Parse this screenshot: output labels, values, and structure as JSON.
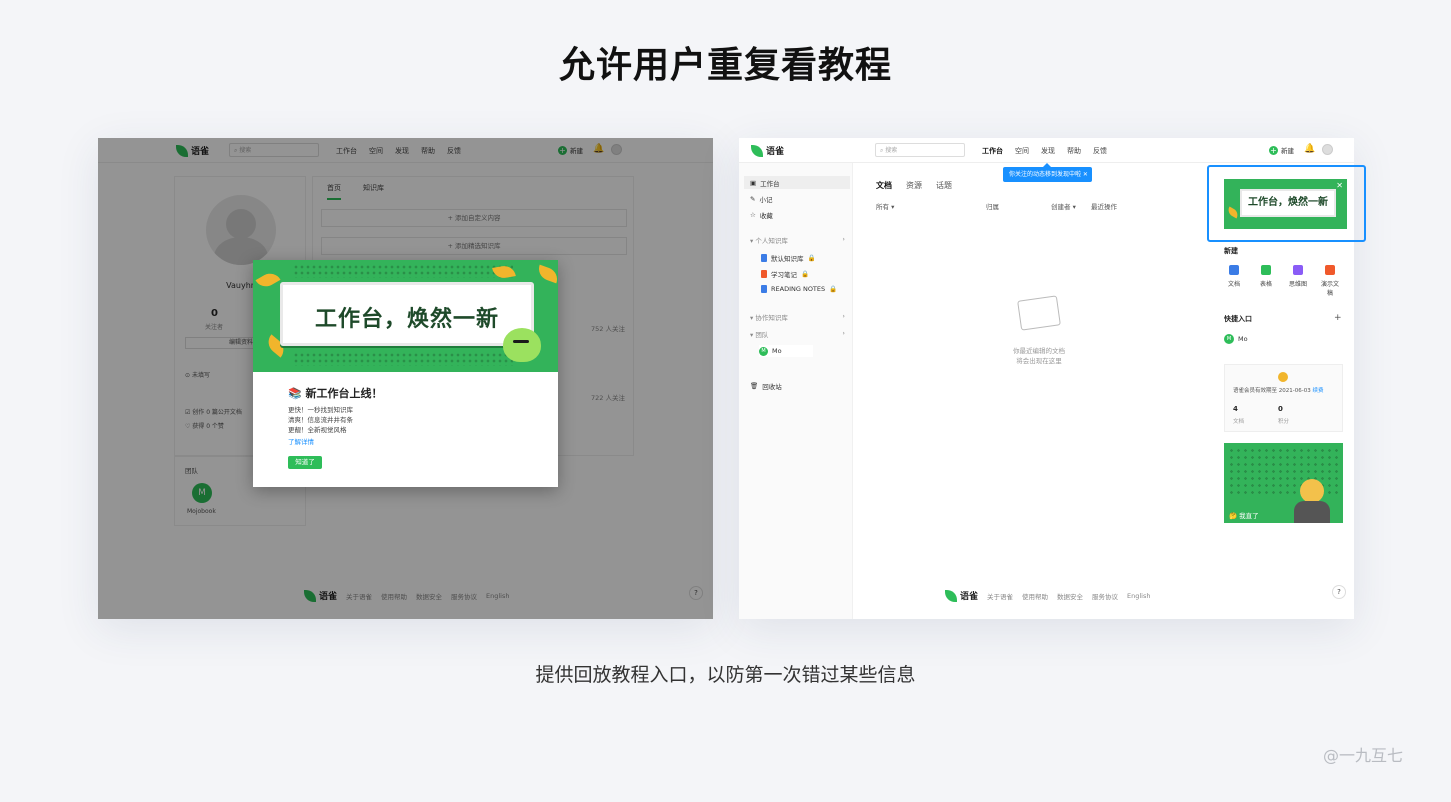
{
  "page": {
    "title": "允许用户重复看教程",
    "caption": "提供回放教程入口，以防第一次错过某些信息",
    "watermark": "@一九互七"
  },
  "app": {
    "logo": "语雀",
    "search_placeholder": "搜索",
    "nav": [
      "工作台",
      "空间",
      "发现",
      "帮助",
      "反馈"
    ],
    "new_label": "新建"
  },
  "left": {
    "profile": {
      "name": "Vauyhn",
      "followers": "0",
      "followers_label": "关注者",
      "edit_button": "编辑资料",
      "location": "未填写",
      "stats1": "创作 0 篇公开文档",
      "stats2": "获得 0 个赞"
    },
    "team": {
      "title": "团队",
      "member": "Mojobook",
      "initial": "M"
    },
    "tabs": [
      "首页",
      "知识库"
    ],
    "add_rows": [
      "+ 添加自定义内容",
      "+ 添加精选知识库"
    ],
    "follow1": "752 人关注",
    "follow2": "722 人关注",
    "modal": {
      "banner_text": "工作台，焕然一新",
      "title": "📚 新工作台上线！",
      "lines": [
        "更快！一秒找到知识库",
        "清爽！信息流井井有条",
        "更靓！全新视觉风格"
      ],
      "link": "了解详情",
      "button": "知道了"
    }
  },
  "footer": {
    "links": [
      "关于语雀",
      "使用帮助",
      "数据安全",
      "服务协议",
      "English"
    ],
    "help": "?"
  },
  "right": {
    "sidebar": {
      "items": [
        "工作台",
        "小记",
        "收藏"
      ],
      "personal_group": "个人知识库",
      "books": [
        "默认知识库",
        "学习笔记",
        "READING NOTES"
      ],
      "collab_group": "协作知识库",
      "team_group": "团队",
      "team_member": "Mo",
      "recycle": "回收站"
    },
    "tabs": [
      "文档",
      "资源",
      "话题"
    ],
    "columns": [
      "所有 ▾",
      "归属",
      "创建者 ▾",
      "最近操作"
    ],
    "empty_line1": "你最近编辑的文档",
    "empty_line2": "将会出现在这里",
    "tooltip": "你关注的动态移到发现中啦 ✕",
    "mini_banner": "工作台，焕然一新",
    "new_title": "新建",
    "new_items": [
      "文档",
      "表格",
      "思维图",
      "演示文稿"
    ],
    "quick_title": "快捷入口",
    "quick_member": "Mo",
    "member_info": "语雀会员有效期至 2021-06-03",
    "member_link": "续费",
    "docs_count": "4",
    "docs_label": "文档",
    "score_count": "0",
    "score_label": "积分",
    "promo_text": "🤔 我直了"
  },
  "colors": {
    "brand": "#2ebd59",
    "accent": "#1890ff"
  }
}
